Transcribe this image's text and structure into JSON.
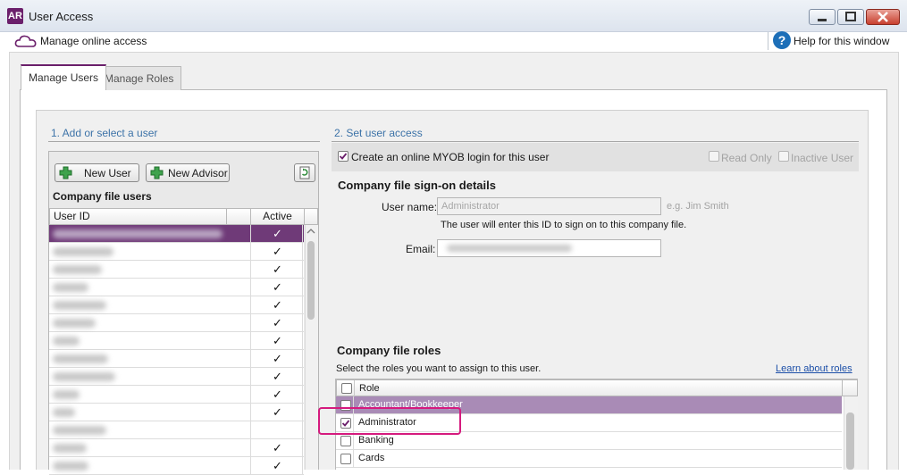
{
  "window": {
    "app_badge": "AR",
    "title": "User Access"
  },
  "subbar": {
    "manage_online": "Manage online access",
    "help": "Help for this window"
  },
  "tabs": [
    {
      "label": "Manage Users",
      "active": true
    },
    {
      "label": "Manage Roles",
      "active": false
    }
  ],
  "left": {
    "heading": "1. Add or select a user",
    "new_user": "New User",
    "new_advisor": "New Advisor",
    "company_users": "Company file users",
    "columns": {
      "user_id": "User ID",
      "active": "Active"
    },
    "rows": [
      {
        "active": true,
        "selected": true
      },
      {
        "active": true
      },
      {
        "active": true
      },
      {
        "active": true
      },
      {
        "active": true
      },
      {
        "active": true
      },
      {
        "active": true
      },
      {
        "active": true
      },
      {
        "active": true
      },
      {
        "active": true
      },
      {
        "active": true
      },
      {
        "active": false
      },
      {
        "active": true
      },
      {
        "active": true
      }
    ]
  },
  "right": {
    "heading": "2. Set user access",
    "create_login": "Create an online MYOB login for this user",
    "read_only": "Read Only",
    "inactive_user": "Inactive User",
    "signon_title": "Company file sign-on details",
    "username_label": "User name:",
    "username_value": "Administrator",
    "username_example": "e.g. Jim Smith",
    "username_hint": "The user will enter this ID to sign on to this company file.",
    "email_label": "Email:",
    "roles_title": "Company file roles",
    "roles_hint": "Select the roles you want to assign to this user.",
    "learn_link": "Learn about roles",
    "roles_col": "Role",
    "roles": [
      {
        "label": "Accountant/Bookkeeper",
        "checked": false,
        "selected": true
      },
      {
        "label": "Administrator",
        "checked": true
      },
      {
        "label": "Banking",
        "checked": false
      },
      {
        "label": "Cards",
        "checked": false
      }
    ]
  },
  "colors": {
    "brand": "#6b1f6b",
    "selection": "#6f3a78",
    "role_selection": "#a98bb6",
    "highlight": "#d51a7e",
    "heading_blue": "#3d73a8"
  }
}
